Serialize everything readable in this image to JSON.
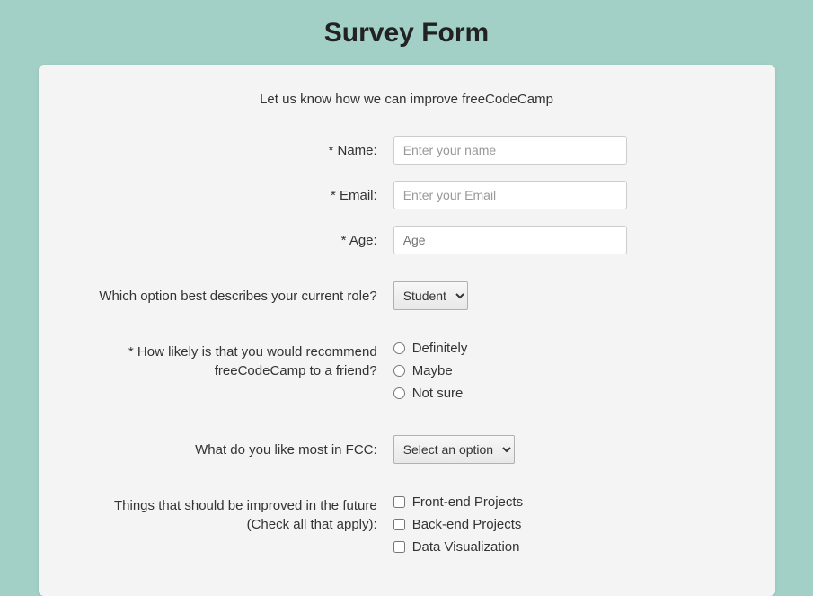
{
  "title": "Survey Form",
  "subtitle": "Let us know how we can improve freeCodeCamp",
  "fields": {
    "name": {
      "label": "* Name:",
      "placeholder": "Enter your name"
    },
    "email": {
      "label": "* Email:",
      "placeholder": "Enter your Email"
    },
    "age": {
      "label": "* Age:",
      "placeholder": "Age"
    },
    "role": {
      "label": "Which option best describes your current role?",
      "selected": "Student"
    },
    "recommend": {
      "label": "* How likely is that you would recommend freeCodeCamp to a friend?",
      "options": [
        "Definitely",
        "Maybe",
        "Not sure"
      ]
    },
    "likeMost": {
      "label": "What do you like most in FCC:",
      "selected": "Select an option"
    },
    "improve": {
      "label": "Things that should be improved in the future (Check all that apply):",
      "options": [
        "Front-end Projects",
        "Back-end Projects",
        "Data Visualization"
      ]
    }
  }
}
